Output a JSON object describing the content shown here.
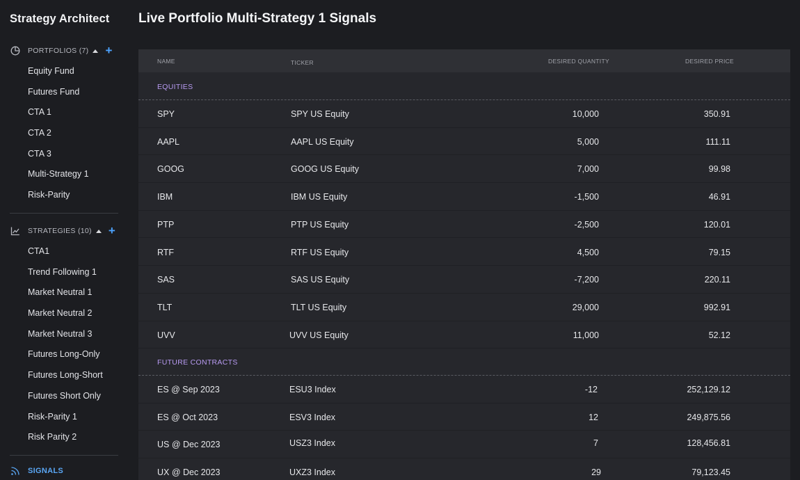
{
  "app_title": "Strategy Architect",
  "page_title": "Live Portfolio Multi-Strategy 1 Signals",
  "sidebar": {
    "portfolios": {
      "label": "PORTFOLIOS (7)",
      "items": [
        "Equity Fund",
        "Futures Fund",
        "CTA 1",
        "CTA 2",
        "CTA 3",
        "Multi-Strategy 1",
        "Risk-Parity"
      ]
    },
    "strategies": {
      "label": "STRATEGIES (10)",
      "items": [
        "CTA1",
        "Trend Following 1",
        "Market Neutral 1",
        "Market Neutral 2",
        "Market Neutral 3",
        "Futures Long-Only",
        "Futures Long-Short",
        "Futures Short Only",
        "Risk-Parity 1",
        "Risk Parity 2"
      ]
    },
    "signals_label": "SIGNALS",
    "accent_color": "#4da3ff"
  },
  "table": {
    "columns": [
      "NAME",
      "TICKER",
      "DESIRED QUANTITY",
      "DESIRED PRICE"
    ],
    "groups": [
      {
        "label": "EQUITIES",
        "rows": [
          {
            "name": "SPY",
            "ticker": "SPY US Equity",
            "qty": "10,000",
            "price": "350.91"
          },
          {
            "name": "AAPL",
            "ticker": "AAPL US Equity",
            "qty": "5,000",
            "price": "111.11"
          },
          {
            "name": "GOOG",
            "ticker": "GOOG US Equity",
            "qty": "7,000",
            "price": "99.98"
          },
          {
            "name": "IBM",
            "ticker": "IBM US Equity",
            "qty": "-1,500",
            "price": "46.91"
          },
          {
            "name": "PTP",
            "ticker": "PTP US Equity",
            "qty": "-2,500",
            "price": "120.01"
          },
          {
            "name": "RTF",
            "ticker": "RTF US Equity",
            "qty": "4,500",
            "price": "79.15"
          },
          {
            "name": "SAS",
            "ticker": "SAS US Equity",
            "qty": "-7,200",
            "price": "220.11"
          },
          {
            "name": "TLT",
            "ticker": "TLT US Equity",
            "qty": "29,000",
            "price": "992.91"
          },
          {
            "name": "UVV",
            "ticker": "UVV US Equity",
            "qty": "11,000",
            "price": "52.12"
          }
        ]
      },
      {
        "label": "FUTURE CONTRACTS",
        "rows": [
          {
            "name": "ES @ Sep 2023",
            "ticker": "ESU3 Index",
            "qty": "-12",
            "price": "252,129.12"
          },
          {
            "name": "ES @ Oct 2023",
            "ticker": "ESV3 Index",
            "qty": "12",
            "price": "249,875.56"
          },
          {
            "name": "US @ Dec 2023",
            "ticker": "USZ3 Index",
            "qty": "7",
            "price": "128,456.81"
          },
          {
            "name": "UX @ Dec 2023",
            "ticker": "UXZ3 Index",
            "qty": "29",
            "price": "79,123.45"
          }
        ]
      }
    ]
  }
}
